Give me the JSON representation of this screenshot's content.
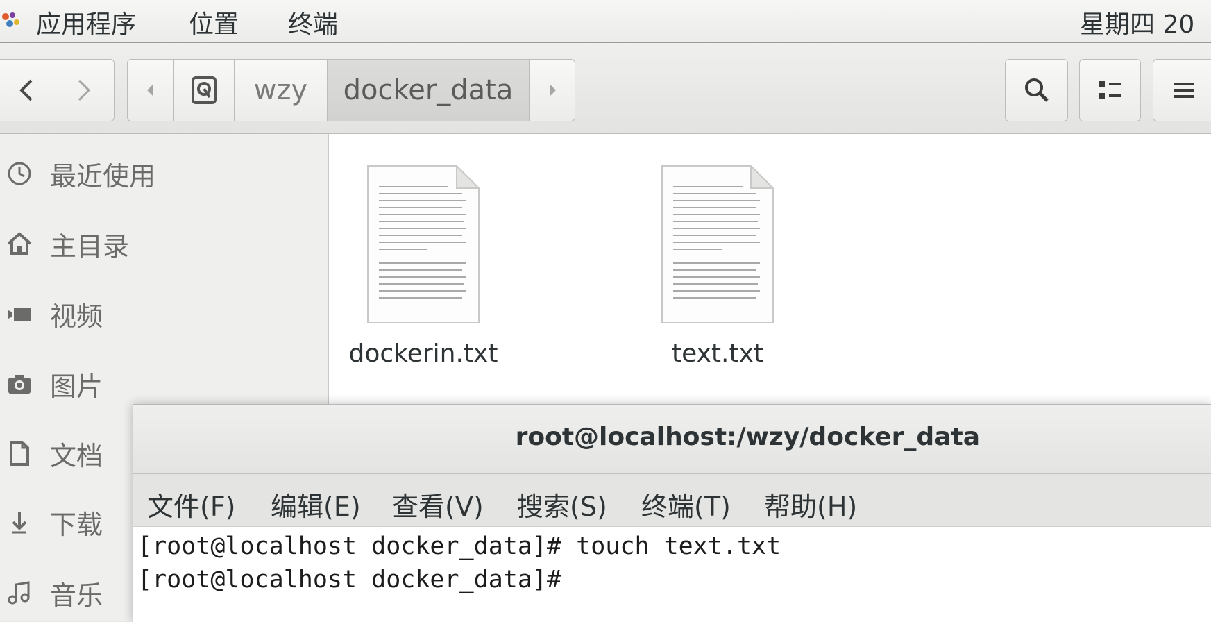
{
  "topbar": {
    "menus": [
      "应用程序",
      "位置",
      "终端"
    ],
    "clock": "星期四 20"
  },
  "headerbar": {
    "breadcrumbs": [
      "wzy",
      "docker_data"
    ],
    "icons": [
      "back-icon",
      "forward-icon",
      "scroll-left-icon",
      "drive-icon",
      "scroll-right-icon",
      "search-icon",
      "list-view-icon",
      "menu-icon"
    ]
  },
  "sidebar": {
    "items": [
      {
        "label": "最近使用",
        "icon": "clock-icon"
      },
      {
        "label": "主目录",
        "icon": "home-icon"
      },
      {
        "label": "视频",
        "icon": "video-icon"
      },
      {
        "label": "图片",
        "icon": "camera-icon"
      },
      {
        "label": "文档",
        "icon": "document-icon"
      },
      {
        "label": "下载",
        "icon": "download-icon"
      },
      {
        "label": "音乐",
        "icon": "music-icon"
      }
    ]
  },
  "files": [
    {
      "name": "dockerin.txt"
    },
    {
      "name": "text.txt"
    }
  ],
  "terminal": {
    "title": "root@localhost:/wzy/docker_data",
    "menus": [
      "文件(F)",
      "编辑(E)",
      "查看(V)",
      "搜索(S)",
      "终端(T)",
      "帮助(H)"
    ],
    "lines": [
      "[root@localhost docker_data]# touch text.txt",
      "[root@localhost docker_data]# "
    ]
  }
}
